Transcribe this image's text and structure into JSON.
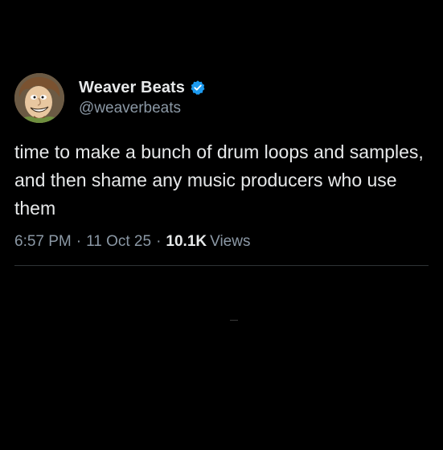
{
  "post": {
    "author": {
      "display_name": "Weaver Beats",
      "handle": "@weaverbeats",
      "verified": true,
      "verified_icon": "verified-badge-icon",
      "verified_color": "#1d9bf0"
    },
    "text": "time to make a bunch of drum loops and samples, and then shame any music producers who use them",
    "time": "6:57 PM",
    "date": "11 Oct 25",
    "separator": "·",
    "views_count": "10.1K",
    "views_label": "Views"
  },
  "colors": {
    "background": "#000000",
    "primary_text": "#e7e9ea",
    "secondary_text": "#8b98a5",
    "divider": "#2f3336"
  }
}
